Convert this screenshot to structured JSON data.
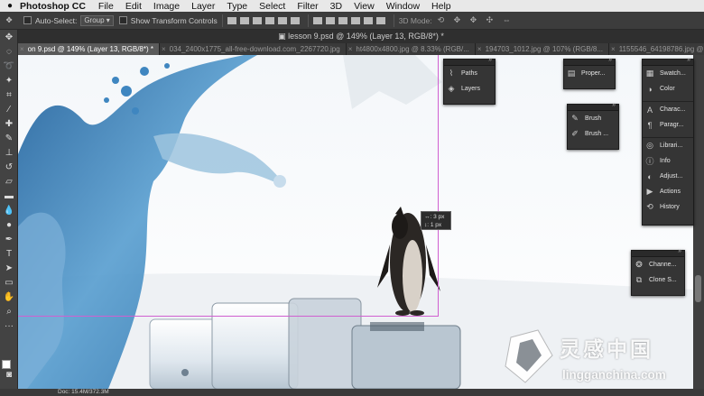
{
  "menubar": {
    "app": "Photoshop CC",
    "items": [
      "File",
      "Edit",
      "Image",
      "Layer",
      "Type",
      "Select",
      "Filter",
      "3D",
      "View",
      "Window",
      "Help"
    ]
  },
  "options": {
    "auto_select": "Auto-Select:",
    "group_value": "Group",
    "show_transform": "Show Transform Controls",
    "mode_3d": "3D Mode:"
  },
  "window_title": "lesson 9.psd @ 149% (Layer 13, RGB/8*) *",
  "tabs": [
    {
      "label": "on 9.psd @ 149% (Layer 13, RGB/8*) *",
      "active": true
    },
    {
      "label": "034_2400x1775_all-free-download.com_2267720.jpg",
      "active": false
    },
    {
      "label": "ht4800x4800.jpg @ 8.33% (RGB/...",
      "active": false
    },
    {
      "label": "194703_1012.jpg @ 107% (RGB/8...",
      "active": false
    },
    {
      "label": "1155546_64198786.jpg @",
      "active": false
    }
  ],
  "measure": {
    "line1": "↔: 3 px",
    "line2": "↕: 1 px"
  },
  "panels": {
    "paths_group": [
      {
        "icon": "paths-icon",
        "label": "Paths"
      },
      {
        "icon": "layers-icon",
        "label": "Layers"
      }
    ],
    "properties_group": [
      {
        "icon": "properties-icon",
        "label": "Proper..."
      }
    ],
    "brush_group": [
      {
        "icon": "brush-icon",
        "label": "Brush"
      },
      {
        "icon": "brush-presets-icon",
        "label": "Brush ..."
      }
    ],
    "right_dock": [
      {
        "icon": "swatches-icon",
        "label": "Swatch..."
      },
      {
        "icon": "color-icon",
        "label": "Color"
      },
      {
        "icon": "character-icon",
        "label": "Charac..."
      },
      {
        "icon": "paragraph-icon",
        "label": "Paragr..."
      },
      {
        "icon": "libraries-icon",
        "label": "Librari..."
      },
      {
        "icon": "info-icon",
        "label": "Info"
      },
      {
        "icon": "adjustments-icon",
        "label": "Adjust..."
      },
      {
        "icon": "actions-icon",
        "label": "Actions"
      },
      {
        "icon": "history-icon",
        "label": "History"
      }
    ],
    "channels_group": [
      {
        "icon": "channels-icon",
        "label": "Channe..."
      },
      {
        "icon": "clone-source-icon",
        "label": "Clone S..."
      }
    ]
  },
  "status": {
    "doc": "Doc: 15.4M/372.3M"
  },
  "watermark": {
    "cn": "灵感中国",
    "en": "lingganchina.com"
  }
}
